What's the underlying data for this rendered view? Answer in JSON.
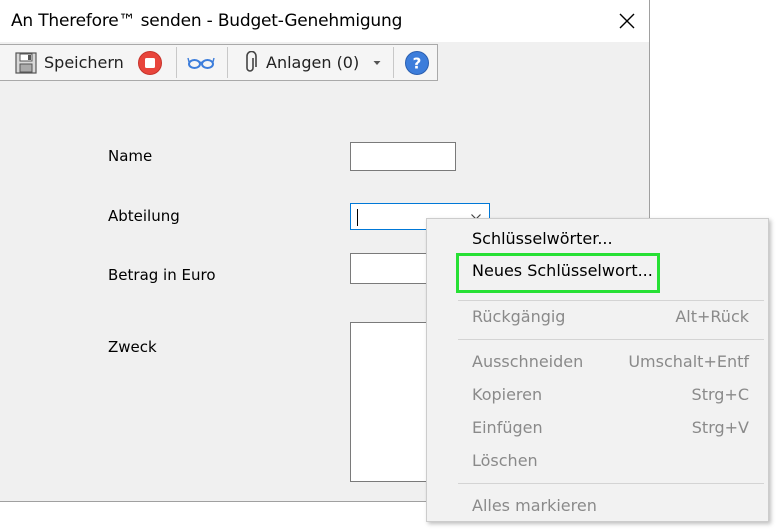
{
  "window": {
    "title": "An Therefore™ senden - Budget-Genehmigung"
  },
  "toolbar": {
    "save_label": "Speichern",
    "attachments_label": "Anlagen (0)"
  },
  "form": {
    "name_label": "Name",
    "department_label": "Abteilung",
    "amount_label": "Betrag in Euro",
    "purpose_label": "Zweck",
    "name_value": "",
    "department_value": "",
    "amount_value": "",
    "purpose_value": ""
  },
  "context_menu": {
    "items": [
      {
        "label": "Schlüsselwörter...",
        "shortcut": "",
        "enabled": true
      },
      {
        "label": "Neues Schlüsselwort...",
        "shortcut": "",
        "enabled": true,
        "highlighted": true
      },
      {
        "label": "Rückgängig",
        "shortcut": "Alt+Rück",
        "enabled": false
      },
      {
        "label": "Ausschneiden",
        "shortcut": "Umschalt+Entf",
        "enabled": false
      },
      {
        "label": "Kopieren",
        "shortcut": "Strg+C",
        "enabled": false
      },
      {
        "label": "Einfügen",
        "shortcut": "Strg+V",
        "enabled": false
      },
      {
        "label": "Löschen",
        "shortcut": "",
        "enabled": false
      },
      {
        "label": "Alles markieren",
        "shortcut": "",
        "enabled": false
      }
    ]
  },
  "colors": {
    "highlight_border": "#27e034",
    "focus_border": "#0078d7",
    "stop_icon": "#e8453c",
    "help_icon": "#3c7ddb"
  }
}
